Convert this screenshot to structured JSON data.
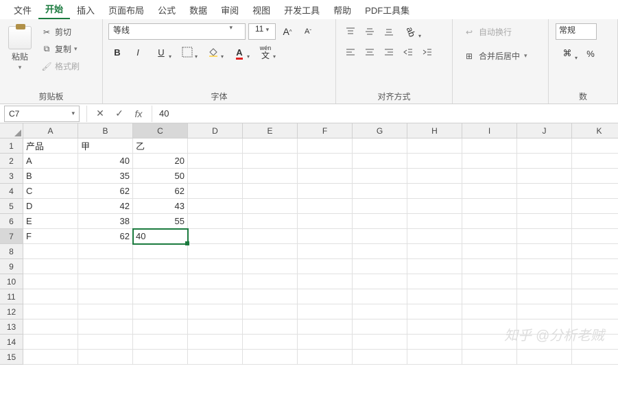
{
  "tabs": {
    "file": "文件",
    "home": "开始",
    "insert": "插入",
    "layout": "页面布局",
    "formulas": "公式",
    "data": "数据",
    "review": "审阅",
    "view": "视图",
    "dev": "开发工具",
    "help": "帮助",
    "pdf": "PDF工具集"
  },
  "ribbon": {
    "paste": "粘贴",
    "cut": "剪切",
    "copy": "复制",
    "format_painter": "格式刷",
    "clipboard_group": "剪贴板",
    "font_name": "等线",
    "font_size": "11",
    "font_group": "字体",
    "align_group": "对齐方式",
    "wrap_text": "自动换行",
    "merge_center": "合并后居中",
    "number_format": "常规",
    "number_group": "数",
    "wen": "wén"
  },
  "fx": {
    "namebox": "C7",
    "fx_label": "fx",
    "value": "40"
  },
  "columns": [
    "A",
    "B",
    "C",
    "D",
    "E",
    "F",
    "G",
    "H",
    "I",
    "J",
    "K"
  ],
  "rows": [
    "1",
    "2",
    "3",
    "4",
    "5",
    "6",
    "7",
    "8",
    "9",
    "10",
    "11",
    "12",
    "13",
    "14",
    "15"
  ],
  "selected": {
    "row": 7,
    "col": "C"
  },
  "data": {
    "A1": "产品",
    "B1": "甲",
    "C1": "乙",
    "A2": "A",
    "B2": "40",
    "C2": "20",
    "A3": "B",
    "B3": "35",
    "C3": "50",
    "A4": "C",
    "B4": "62",
    "C4": "62",
    "A5": "D",
    "B5": "42",
    "C5": "43",
    "A6": "E",
    "B6": "38",
    "C6": "55",
    "A7": "F",
    "B7": "62",
    "C7": "40"
  },
  "watermark": "知乎 @分析老贼"
}
